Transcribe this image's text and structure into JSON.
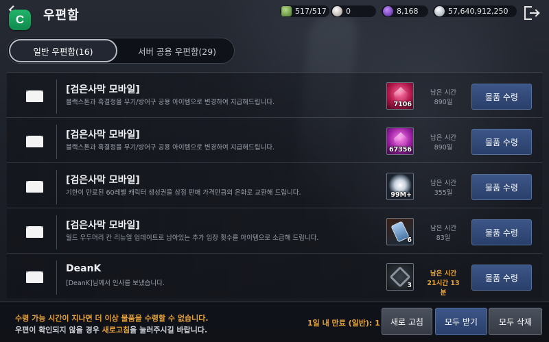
{
  "header": {
    "title": "우편함",
    "app_badge": "C",
    "resources": [
      {
        "name": "weight-icon",
        "value": "517/517",
        "color": "#8fbf5a"
      },
      {
        "name": "pearl-icon",
        "value": "0",
        "color": "#e8e0d8"
      },
      {
        "name": "black-stone-icon",
        "value": "8,168",
        "color": "#8a3fe0"
      },
      {
        "name": "silver-icon",
        "value": "57,640,912,250",
        "color": "#c8d0da"
      }
    ]
  },
  "tabs": [
    {
      "label": "일반 우편함(16)",
      "active": true
    },
    {
      "label": "서버 공용 우편함(29)",
      "active": false
    }
  ],
  "mails": [
    {
      "sender": "[검은사막 모바일]",
      "message": "블랙스톤과 흑결정을 무기/방어구 공용 아이템으로 변경하여 지급해드립니다.",
      "item": "red-crystal",
      "qty": "7106",
      "time_label": "남은 시간",
      "time_value": "890일",
      "button": "물품 수령"
    },
    {
      "sender": "[검은사막 모바일]",
      "message": "블랙스톤과 흑결정을 무기/방어구 공용 아이템으로 변경하여 지급해드립니다.",
      "item": "purple-crystal",
      "qty": "67356",
      "time_label": "남은 시간",
      "time_value": "890일",
      "button": "물품 수령"
    },
    {
      "sender": "[검은사막 모바일]",
      "message": "기한이 만료된 60레벨 캐릭터 생성권을 상점 판매 가격만큼의 은화로 교환해 드립니다.",
      "item": "silver-coin",
      "qty": "99M+",
      "time_label": "남은 시간",
      "time_value": "355일",
      "button": "물품 수령"
    },
    {
      "sender": "[검은사막 모바일]",
      "message": "월드 우두머리 칸 리뉴얼 업데이트로 남아있는 추가 입장 횟수를 아이템으로 소급해 드립니다.",
      "item": "scroll",
      "qty": "6",
      "time_label": "남은 시간",
      "time_value": "83일",
      "button": "물품 수령"
    },
    {
      "sender": "DeanK",
      "message": "[DeanK]님께서 인사를 보냈습니다.",
      "item": "emblem",
      "qty": "3",
      "time_label": "남은 시간",
      "time_value": "21시간 13분",
      "button": "물품 수령",
      "warning": true
    }
  ],
  "footer": {
    "notice_line1": "수령 가능 시간이 지나면 더 이상 물품을 수령할 수 없습니다.",
    "notice_line2_a": "우편이 확인되지 않을 경우 ",
    "notice_line2_b": "새로고침",
    "notice_line2_c": "을 눌러주시길 바랍니다.",
    "expire_label": "1일 내 만료 (일반): 1",
    "refresh_button": "새로 고침",
    "claim_all_button": "모두 받기",
    "delete_all_button": "모두 삭제"
  }
}
